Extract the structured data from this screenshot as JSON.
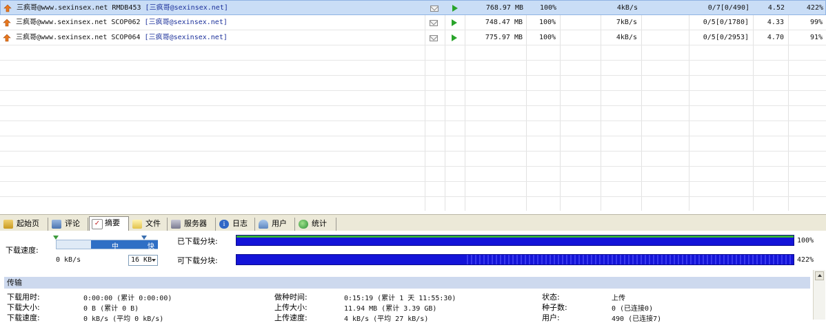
{
  "torrents": [
    {
      "title": "三疯哥@www.sexinsex.net RMDB453",
      "tag": "[三疯哥@sexinsex.net]",
      "size": "768.97 MB",
      "percent": "100%",
      "speed": "4kB/s",
      "peers": "0/7[0/490]",
      "ratio": "4.52",
      "share": "422%",
      "selected": true
    },
    {
      "title": "三疯哥@www.sexinsex.net SCOP062",
      "tag": "[三疯哥@sexinsex.net]",
      "size": "748.47 MB",
      "percent": "100%",
      "speed": "7kB/s",
      "peers": "0/5[0/1780]",
      "ratio": "4.33",
      "share": "99%",
      "selected": false
    },
    {
      "title": "三疯哥@www.sexinsex.net SCOP064",
      "tag": "[三疯哥@sexinsex.net]",
      "size": "775.97 MB",
      "percent": "100%",
      "speed": "4kB/s",
      "peers": "0/5[0/2953]",
      "ratio": "4.70",
      "share": "91%",
      "selected": false
    }
  ],
  "tabs": [
    {
      "label": "起始页",
      "icon": "home-icon"
    },
    {
      "label": "评论",
      "icon": "comment-icon"
    },
    {
      "label": "摘要",
      "icon": "summary-check-icon"
    },
    {
      "label": "文件",
      "icon": "folder-icon"
    },
    {
      "label": "服务器",
      "icon": "server-icon"
    },
    {
      "label": "日志",
      "icon": "info-log-icon"
    },
    {
      "label": "用户",
      "icon": "user-icon"
    },
    {
      "label": "统计",
      "icon": "stats-globe-icon"
    }
  ],
  "summary": {
    "download_speed_label": "下载速度:",
    "slider_mid": "中",
    "slider_fast": "快",
    "current_speed": "0 kB/s",
    "limit_value": "16 KB",
    "downloaded_pieces_label": "已下载分块:",
    "downloaded_pieces_pct": "100%",
    "available_pieces_label": "可下载分块:",
    "available_pieces_pct": "422%"
  },
  "transfer": {
    "section_title": "传输",
    "col1": [
      {
        "label": "下载用时:",
        "value": "0:00:00 (累计 0:00:00)"
      },
      {
        "label": "下载大小:",
        "value": "0 B (累计 0 B)"
      },
      {
        "label": "下载速度:",
        "value": "0 kB/s (平均 0 kB/s)"
      }
    ],
    "col2": [
      {
        "label": "做种时间:",
        "value": "0:15:19 (累计 1 天 11:55:30)"
      },
      {
        "label": "上传大小:",
        "value": "11.94 MB (累计 3.39 GB)"
      },
      {
        "label": "上传速度:",
        "value": "4 kB/s (平均 27 kB/s)"
      }
    ],
    "col3": [
      {
        "label": "状态:",
        "value": "上传"
      },
      {
        "label": "种子数:",
        "value": "0 (已连接0)"
      },
      {
        "label": "用户:",
        "value": "490 (已连接7)"
      }
    ]
  },
  "colors": {
    "accent": "#1414d8",
    "selection": "#c9ddf6",
    "link": "#1a2f9a",
    "play": "#29a42a"
  }
}
